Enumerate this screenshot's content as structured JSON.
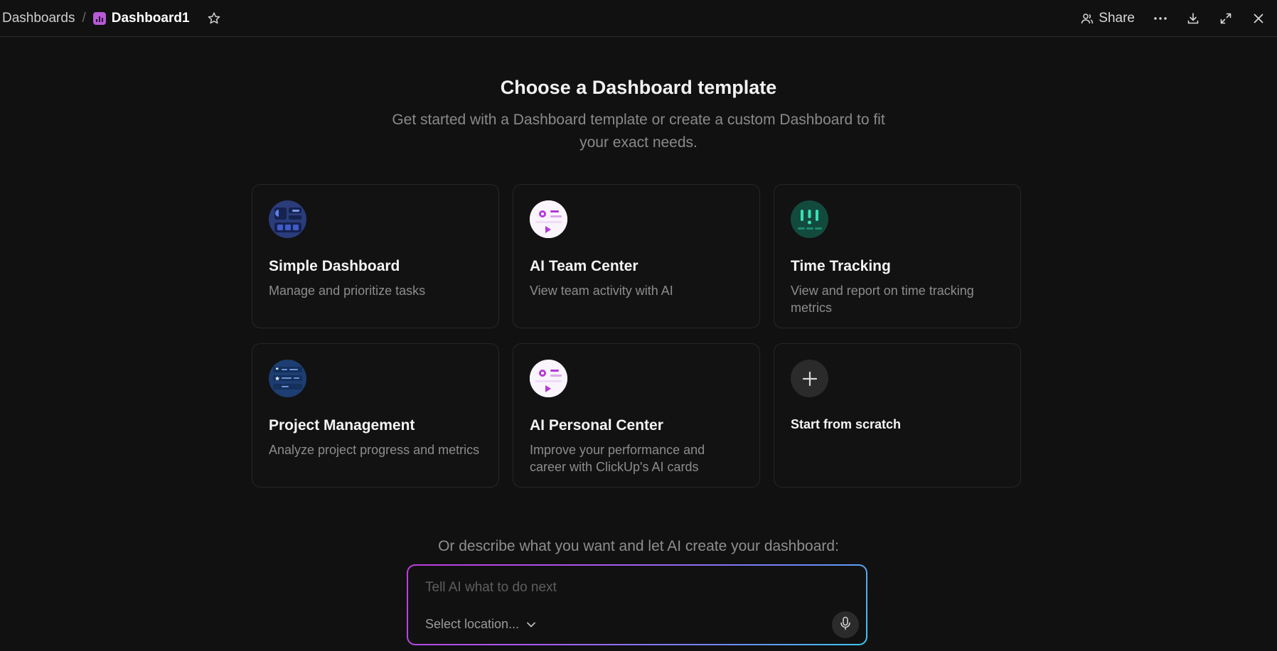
{
  "breadcrumb": {
    "root": "Dashboards",
    "separator": "/",
    "current": "Dashboard1"
  },
  "header_actions": {
    "share_label": "Share",
    "icons": [
      "share-icon",
      "more-icon",
      "download-icon",
      "expand-icon",
      "close-icon"
    ]
  },
  "main": {
    "title": "Choose a Dashboard template",
    "subtitle": "Get started with a Dashboard template or create a custom Dashboard to fit your exact needs."
  },
  "templates": [
    {
      "title": "Simple Dashboard",
      "description": "Manage and prioritize tasks",
      "icon": "simple-dashboard-icon"
    },
    {
      "title": "AI Team Center",
      "description": "View team activity with AI",
      "icon": "ai-team-center-icon"
    },
    {
      "title": "Time Tracking",
      "description": "View and report on time tracking metrics",
      "icon": "time-tracking-icon"
    },
    {
      "title": "Project Management",
      "description": "Analyze project progress and metrics",
      "icon": "project-management-icon"
    },
    {
      "title": "AI Personal Center",
      "description": "Improve your performance and career with ClickUp's AI cards",
      "icon": "ai-personal-center-icon"
    },
    {
      "title": "Start from scratch",
      "description": "",
      "icon": "plus-icon"
    }
  ],
  "ai": {
    "prompt": "Or describe what you want and let AI create your dashboard:",
    "placeholder": "Tell AI what to do next",
    "location_label": "Select location..."
  },
  "colors": {
    "background": "#111111",
    "accent_purple": "#b65ad6",
    "gradient_start": "#c13be0",
    "gradient_end": "#3ec7f2"
  }
}
